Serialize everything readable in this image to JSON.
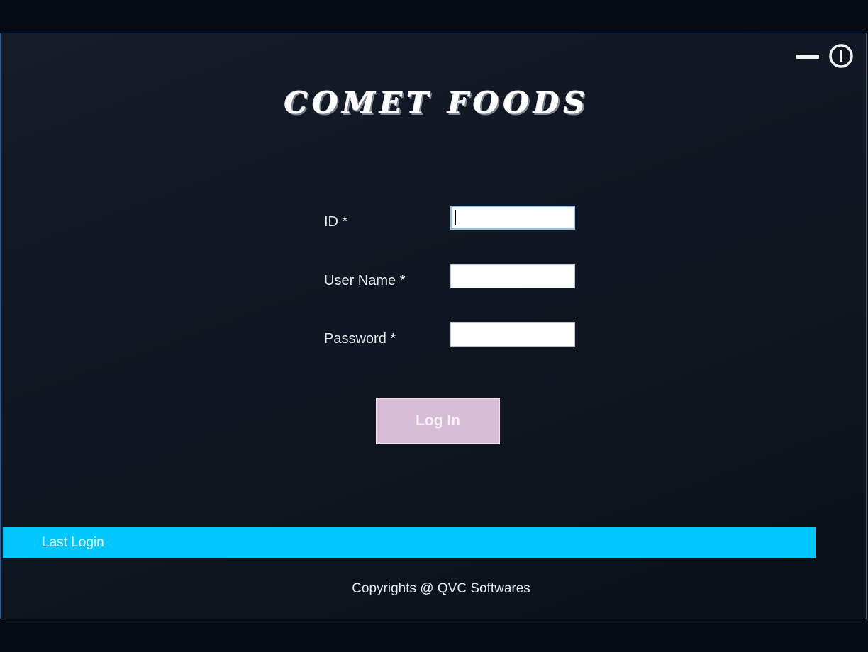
{
  "app": {
    "title": "COMET FOODS"
  },
  "window_controls": {
    "minimize_icon": "minimize-icon",
    "power_icon": "power-icon"
  },
  "form": {
    "id_label": "ID *",
    "id_value": "",
    "username_label": "User Name *",
    "username_value": "",
    "password_label": "Password *",
    "password_value": "",
    "login_label": "Log In"
  },
  "status": {
    "last_login_label": "Last Login"
  },
  "footer": {
    "copyright": "Copyrights @ QVC Softwares"
  },
  "colors": {
    "background": "#101722",
    "accent_bar": "#00c8ff",
    "login_button": "#d7bcd6"
  }
}
